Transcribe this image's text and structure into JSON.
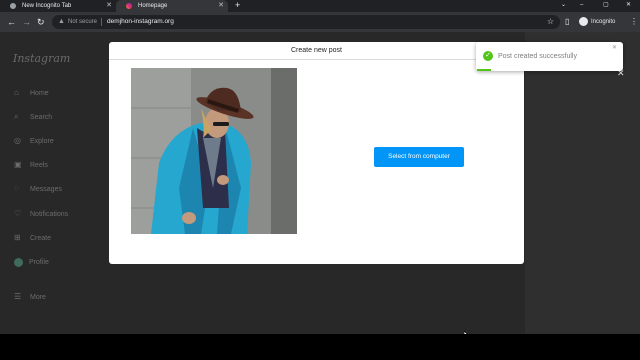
{
  "browser": {
    "tabs": [
      {
        "title": "New Incognito Tab",
        "active": false
      },
      {
        "title": "Homepage",
        "active": true
      }
    ],
    "new_tab": "+",
    "controls": {
      "minimize": "–",
      "maximize": "▢",
      "close": "✕",
      "tab_search": "⌄"
    },
    "nav": {
      "back": "←",
      "forward": "→",
      "reload": "↻"
    },
    "address_bar": {
      "security": "Not secure",
      "url": "demjhon-instagram.org"
    },
    "profile_label": "Incognito"
  },
  "sidebar": {
    "logo": "Instagram",
    "items": [
      {
        "label": "Home",
        "icon": "home-icon",
        "glyph": "⌂"
      },
      {
        "label": "Search",
        "icon": "search-icon",
        "glyph": "⌕"
      },
      {
        "label": "Explore",
        "icon": "compass-icon",
        "glyph": "◎"
      },
      {
        "label": "Reels",
        "icon": "reels-icon",
        "glyph": "▣"
      },
      {
        "label": "Messages",
        "icon": "messenger-icon",
        "glyph": "◌"
      },
      {
        "label": "Notifications",
        "icon": "heart-icon",
        "glyph": "♡"
      },
      {
        "label": "Create",
        "icon": "plus-square-icon",
        "glyph": "⊞"
      },
      {
        "label": "Profile",
        "icon": "avatar-icon",
        "glyph": ""
      },
      {
        "label": "More",
        "icon": "hamburger-menu-icon",
        "glyph": "☰"
      }
    ]
  },
  "modal": {
    "title": "Create new post",
    "select_button": "Select from computer",
    "close": "✕"
  },
  "toast": {
    "message": "Post created successfully",
    "status_color": "#52c41a"
  },
  "colors": {
    "accent": "#0095f6",
    "success": "#52c41a"
  }
}
